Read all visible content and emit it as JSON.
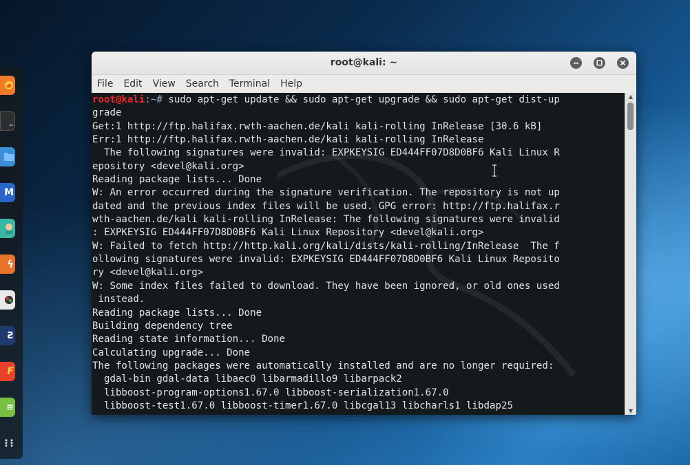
{
  "window": {
    "title": "root@kali: ~"
  },
  "menu": [
    "File",
    "Edit",
    "View",
    "Search",
    "Terminal",
    "Help"
  ],
  "prompt": {
    "user": "root@kali",
    "path": ":~#"
  },
  "terminal": {
    "command_line": " sudo apt-get update && sudo apt-get upgrade && sudo apt-get dist-up",
    "output": [
      "grade",
      "Get:1 http://ftp.halifax.rwth-aachen.de/kali kali-rolling InRelease [30.6 kB]",
      "Err:1 http://ftp.halifax.rwth-aachen.de/kali kali-rolling InRelease",
      "  The following signatures were invalid: EXPKEYSIG ED444FF07D8D0BF6 Kali Linux R",
      "epository <devel@kali.org>",
      "Reading package lists... Done",
      "W: An error occurred during the signature verification. The repository is not up",
      "dated and the previous index files will be used. GPG error: http://ftp.halifax.r",
      "wth-aachen.de/kali kali-rolling InRelease: The following signatures were invalid",
      ": EXPKEYSIG ED444FF07D8D0BF6 Kali Linux Repository <devel@kali.org>",
      "W: Failed to fetch http://http.kali.org/kali/dists/kali-rolling/InRelease  The f",
      "ollowing signatures were invalid: EXPKEYSIG ED444FF07D8D0BF6 Kali Linux Reposito",
      "ry <devel@kali.org>",
      "W: Some index files failed to download. They have been ignored, or old ones used",
      " instead.",
      "Reading package lists... Done",
      "Building dependency tree",
      "Reading state information... Done",
      "Calculating upgrade... Done",
      "The following packages were automatically installed and are no longer required:",
      "  gdal-bin gdal-data libaec0 libarmadillo9 libarpack2",
      "  libboost-program-options1.67.0 libboost-serialization1.67.0",
      "  libboost-test1.67.0 libboost-timer1.67.0 libcgal13 libcharls1 libdap25"
    ]
  },
  "dock": {
    "icons": [
      {
        "name": "firefox-icon",
        "color": "#f07a2a",
        "glyph": ""
      },
      {
        "name": "terminal-icon",
        "color": "#2d2f31",
        "glyph": "_"
      },
      {
        "name": "files-icon",
        "color": "#3b8fd9",
        "glyph": ""
      },
      {
        "name": "metasploit-icon",
        "color": "#2a66c9",
        "glyph": "M"
      },
      {
        "name": "armitage-icon",
        "color": "#38b6a6",
        "glyph": ""
      },
      {
        "name": "burpsuite-icon",
        "color": "#e8732a",
        "glyph": "ϟ"
      },
      {
        "name": "maltego-icon",
        "color": "#e9e9e9",
        "glyph": "●"
      },
      {
        "name": "beef-icon",
        "color": "#1f3a70",
        "glyph": "Ƨ"
      },
      {
        "name": "faraday-icon",
        "color": "#e8402a",
        "glyph": "F"
      },
      {
        "name": "leafpad-icon",
        "color": "#77c043",
        "glyph": "≡"
      },
      {
        "name": "show-apps-icon",
        "color": "transparent",
        "glyph": "⠿"
      }
    ]
  },
  "colors": {
    "terminal_bg": "#14191c",
    "terminal_fg": "#e3e3e3",
    "prompt_user": "#ef2929",
    "prompt_path": "#9fb7d0",
    "titlebar_bg": "#efefee"
  }
}
